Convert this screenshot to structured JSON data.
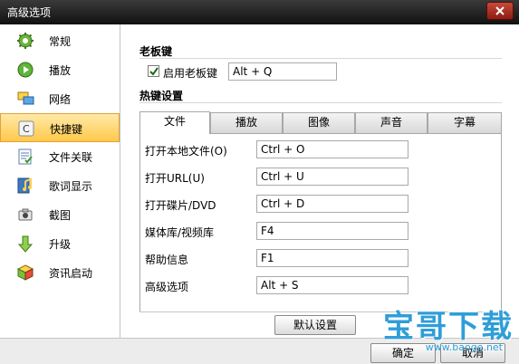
{
  "window": {
    "title": "高级选项"
  },
  "sidebar": {
    "items": [
      {
        "label": "常规",
        "icon": "gear-icon",
        "selected": false
      },
      {
        "label": "播放",
        "icon": "play-icon",
        "selected": false
      },
      {
        "label": "网络",
        "icon": "network-icon",
        "selected": false
      },
      {
        "label": "快捷键",
        "icon": "keyboard-key-icon",
        "selected": true
      },
      {
        "label": "文件关联",
        "icon": "file-association-icon",
        "selected": false
      },
      {
        "label": "歌词显示",
        "icon": "lyrics-music-icon",
        "selected": false
      },
      {
        "label": "截图",
        "icon": "camera-icon",
        "selected": false
      },
      {
        "label": "升级",
        "icon": "download-arrow-icon",
        "selected": false
      },
      {
        "label": "资讯启动",
        "icon": "cube-icon",
        "selected": false
      }
    ]
  },
  "boss_key": {
    "section_title": "老板键",
    "checkbox_label": "启用老板键",
    "checked": true,
    "value": "Alt + Q"
  },
  "hotkeys": {
    "section_title": "热键设置",
    "tabs": [
      {
        "label": "文件",
        "active": true
      },
      {
        "label": "播放",
        "active": false
      },
      {
        "label": "图像",
        "active": false
      },
      {
        "label": "声音",
        "active": false
      },
      {
        "label": "字幕",
        "active": false
      }
    ],
    "rows": [
      {
        "label": "打开本地文件(O)",
        "value": "Ctrl + O"
      },
      {
        "label": "打开URL(U)",
        "value": "Ctrl + U"
      },
      {
        "label": "打开碟片/DVD",
        "value": "Ctrl + D"
      },
      {
        "label": "媒体库/视频库",
        "value": "F4"
      },
      {
        "label": "帮助信息",
        "value": "F1"
      },
      {
        "label": "高级选项",
        "value": "Alt + S"
      }
    ],
    "default_button": "默认设置"
  },
  "footer": {
    "ok_button": "确定",
    "cancel_button": "取消"
  },
  "watermark": {
    "text": "宝哥下载",
    "url": "www.baoge.net"
  },
  "colors": {
    "selected_item_bg": "#ffc94a",
    "titlebar_bg": "#1a1a1a",
    "close_button": "#b03020",
    "watermark": "#2f9ed8"
  }
}
